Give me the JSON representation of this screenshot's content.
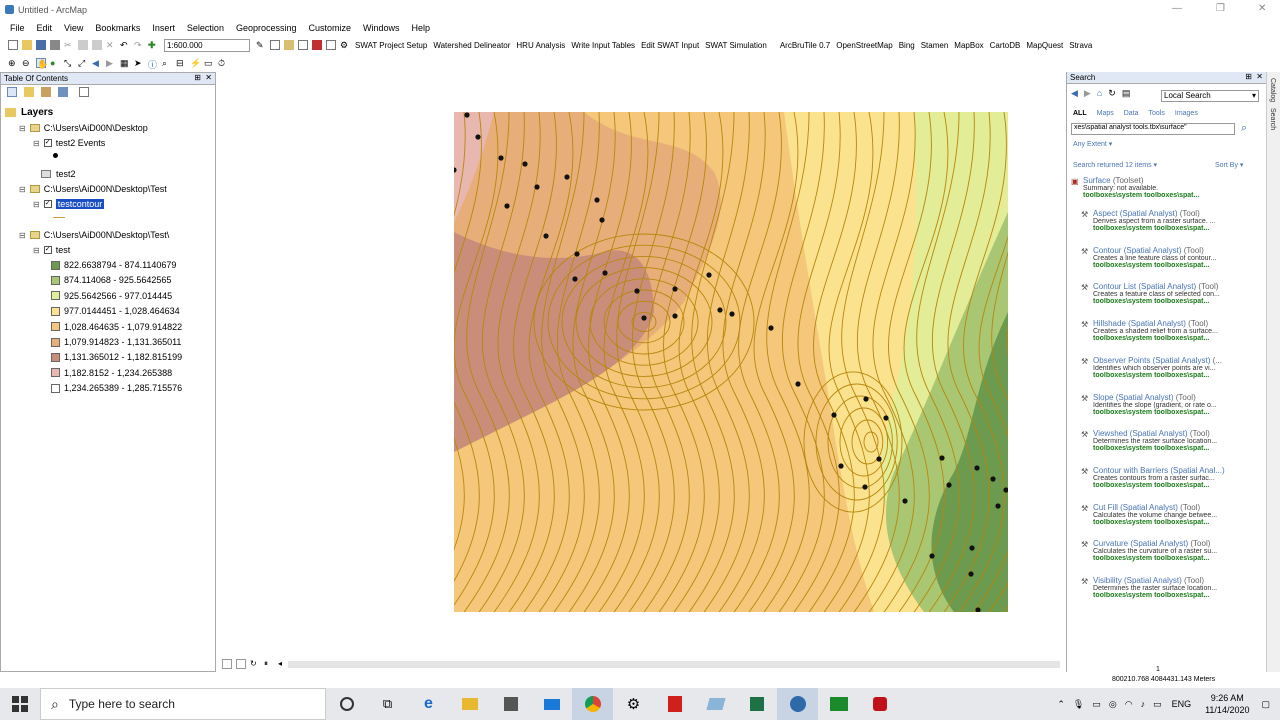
{
  "window": {
    "title": "Untitled - ArcMap"
  },
  "menu": [
    "File",
    "Edit",
    "View",
    "Bookmarks",
    "Insert",
    "Selection",
    "Geoprocessing",
    "Customize",
    "Windows",
    "Help"
  ],
  "toolbar": {
    "scale": "1:600.000",
    "items": [
      "SWAT Project Setup",
      "Watershed Delineator",
      "HRU Analysis",
      "Write Input Tables",
      "Edit SWAT Input",
      "SWAT Simulation",
      "ArcBruTile 0.7",
      "OpenStreetMap",
      "Bing",
      "Stamen",
      "MapBox",
      "CartoDB",
      "MapQuest",
      "Strava"
    ]
  },
  "toc": {
    "title": "Table Of Contents",
    "layers_label": "Layers",
    "groups": [
      {
        "path": "C:\\Users\\AiD00N\\Desktop",
        "layer": "test2 Events",
        "sub": "test2"
      },
      {
        "path": "C:\\Users\\AiD00N\\Desktop\\Test",
        "layer": "testcontour"
      },
      {
        "path": "C:\\Users\\AiD00N\\Desktop\\Test\\",
        "layer": "test"
      }
    ],
    "legend": [
      {
        "label": "822.6638794 - 874.1140679",
        "color": "#6c9a4e"
      },
      {
        "label": "874.114068 - 925.5642565",
        "color": "#a9c672"
      },
      {
        "label": "925.5642566 - 977.014445",
        "color": "#e3ec96"
      },
      {
        "label": "977.0144451 - 1,028.464634",
        "color": "#fbe28f"
      },
      {
        "label": "1,028.464635 - 1,079.914822",
        "color": "#f4c77a"
      },
      {
        "label": "1,079.914823 - 1,131.365011",
        "color": "#e8ae7a"
      },
      {
        "label": "1,131.365012 - 1,182.815199",
        "color": "#c98e7a"
      },
      {
        "label": "1,182.8152 - 1,234.265388",
        "color": "#e8b8b0"
      },
      {
        "label": "1,234.265389 - 1,285.715576",
        "color": "#ffffff"
      }
    ]
  },
  "search": {
    "title": "Search",
    "mode": "Local Search",
    "tabs": [
      "ALL",
      "Maps",
      "Data",
      "Tools",
      "Images"
    ],
    "query": "xes\\spatial analyst tools.tbx\\surface\"",
    "extent": "Any Extent",
    "returned": "Search returned 12 items",
    "sort": "Sort By",
    "results": [
      {
        "name": "Surface",
        "tag": "Spatial Analyst",
        "kind": "(Toolset)",
        "desc": "Summary: not available.",
        "path": "toolboxes\\system toolboxes\\spat..."
      },
      {
        "name": "Aspect",
        "tag": "Spatial Analyst",
        "kind": "(Tool)",
        "desc": "Derives aspect from a raster surface. ...",
        "path": "toolboxes\\system toolboxes\\spat..."
      },
      {
        "name": "Contour",
        "tag": "Spatial Analyst",
        "kind": "(Tool)",
        "desc": "Creates a line feature class of contour...",
        "path": "toolboxes\\system toolboxes\\spat..."
      },
      {
        "name": "Contour List",
        "tag": "Spatial Analyst",
        "kind": "(Tool)",
        "desc": "Creates a feature class of selected con...",
        "path": "toolboxes\\system toolboxes\\spat..."
      },
      {
        "name": "Hillshade",
        "tag": "Spatial Analyst",
        "kind": "(Tool)",
        "desc": "Creates a shaded relief from a surface...",
        "path": "toolboxes\\system toolboxes\\spat..."
      },
      {
        "name": "Observer Points",
        "tag": "Spatial Analyst",
        "kind": "(...",
        "desc": "Identifies which observer points are vi...",
        "path": "toolboxes\\system toolboxes\\spat..."
      },
      {
        "name": "Slope",
        "tag": "Spatial Analyst",
        "kind": "(Tool)",
        "desc": "Identifies the slope (gradient, or rate o...",
        "path": "toolboxes\\system toolboxes\\spat..."
      },
      {
        "name": "Viewshed",
        "tag": "Spatial Analyst",
        "kind": "(Tool)",
        "desc": "Determines the raster surface location...",
        "path": "toolboxes\\system toolboxes\\spat..."
      },
      {
        "name": "Contour with Barriers",
        "tag": "Spatial Anal...",
        "kind": "",
        "desc": "Creates contours from a raster surfac...",
        "path": "toolboxes\\system toolboxes\\spat..."
      },
      {
        "name": "Cut Fill",
        "tag": "Spatial Analyst",
        "kind": "(Tool)",
        "desc": "Calculates the volume change betwee...",
        "path": "toolboxes\\system toolboxes\\spat..."
      },
      {
        "name": "Curvature",
        "tag": "Spatial Analyst",
        "kind": "(Tool)",
        "desc": "Calculates the curvature of a raster su...",
        "path": "toolboxes\\system toolboxes\\spat..."
      },
      {
        "name": "Visibility",
        "tag": "Spatial Analyst",
        "kind": "(Tool)",
        "desc": "Determines the raster surface location...",
        "path": "toolboxes\\system toolboxes\\spat..."
      }
    ]
  },
  "sidetabs": [
    "Catalog",
    "Search"
  ],
  "status": {
    "page": "1",
    "coords": "800210.768  4084431.143 Meters"
  },
  "taskbar": {
    "search_placeholder": "Type here to search",
    "time": "9:26 AM",
    "date": "11/14/2020",
    "lang": "ENG"
  }
}
